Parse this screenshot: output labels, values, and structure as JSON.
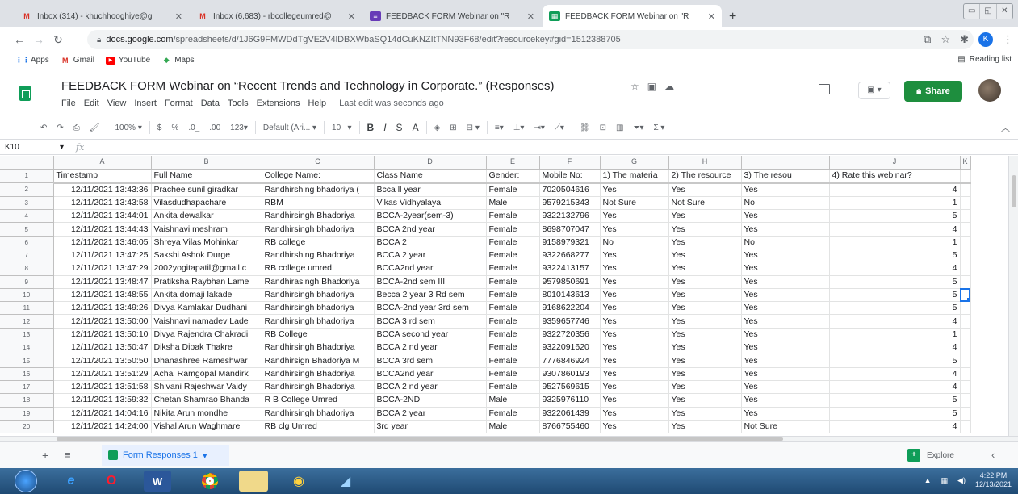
{
  "browser": {
    "tabs": [
      {
        "title": "Inbox (314) - khuchhooghiye@g",
        "favicon": "gmail-icon",
        "active": false
      },
      {
        "title": "Inbox (6,683) - rbcollegeumred@",
        "favicon": "gmail-icon",
        "active": false
      },
      {
        "title": "FEEDBACK FORM Webinar on \"R",
        "favicon": "forms-icon",
        "active": false
      },
      {
        "title": "FEEDBACK FORM Webinar on \"R",
        "favicon": "sheets-icon",
        "active": true
      }
    ],
    "url_domain": "docs.google.com",
    "url_path": "/spreadsheets/d/1J6G9FMWDdTgVE2V4lDBXWbaSQ14dCuKNZItTNN93F68/edit?resourcekey#gid=1512388705",
    "bookmarks": [
      {
        "label": "Apps",
        "icon": "apps-grid-icon"
      },
      {
        "label": "Gmail",
        "icon": "gmail-icon"
      },
      {
        "label": "YouTube",
        "icon": "youtube-icon"
      },
      {
        "label": "Maps",
        "icon": "maps-icon"
      }
    ],
    "reading_list": "Reading list",
    "profile_initial": "K"
  },
  "sheets": {
    "doc_title": "FEEDBACK FORM Webinar on “Recent Trends and Technology in Corporate.” (Responses)",
    "menu": [
      "File",
      "Edit",
      "View",
      "Insert",
      "Format",
      "Data",
      "Tools",
      "Extensions",
      "Help"
    ],
    "last_edit": "Last edit was seconds ago",
    "share_label": "Share",
    "toolbar": {
      "zoom": "100%",
      "currency": "$",
      "percent": "%",
      "dec_less": ".0_",
      "dec_more": ".00",
      "format_more": "123",
      "font": "Default (Ari...",
      "font_size": "10"
    },
    "name_box": "K10",
    "fx": "fx",
    "sheet_tab": "Form Responses 1",
    "explore_label": "Explore"
  },
  "grid": {
    "columns": [
      "A",
      "B",
      "C",
      "D",
      "E",
      "F",
      "G",
      "H",
      "I",
      "J",
      "K"
    ],
    "header": [
      "Timestamp",
      "Full Name",
      "College Name:",
      "Class Name",
      "Gender:",
      "Mobile No:",
      "1) The materia",
      "2) The resource",
      "3) The resou",
      "4) Rate this webinar?",
      ""
    ],
    "rows": [
      [
        "12/11/2021 13:43:36",
        "Prachee sunil giradkar",
        "Randhirshing bhadoriya (",
        "Bcca ll year",
        "Female",
        "7020504616",
        "Yes",
        "Yes",
        "Yes",
        "4",
        ""
      ],
      [
        "12/11/2021 13:43:58",
        "Vilasdudhapachare",
        "RBM",
        "Vikas Vidhyalaya",
        "Male",
        "9579215343",
        "Not Sure",
        "Not Sure",
        "No",
        "1",
        ""
      ],
      [
        "12/11/2021 13:44:01",
        "Ankita dewalkar",
        "Randhirsingh Bhadoriya",
        "BCCA-2year(sem-3)",
        "Female",
        "9322132796",
        "Yes",
        "Yes",
        "Yes",
        "5",
        ""
      ],
      [
        "12/11/2021 13:44:43",
        "Vaishnavi meshram",
        "Randhirsingh bhadoriya",
        "BCCA 2nd year",
        "Female",
        "8698707047",
        "Yes",
        "Yes",
        "Yes",
        "4",
        ""
      ],
      [
        "12/11/2021 13:46:05",
        "Shreya Vilas Mohinkar",
        "RB college",
        "BCCA 2",
        "Female",
        "9158979321",
        "No",
        "Yes",
        "No",
        "1",
        ""
      ],
      [
        "12/11/2021 13:47:25",
        "Sakshi Ashok Durge",
        "Randhirshing Bhadoriya",
        "BCCA 2 year",
        "Female",
        "9322668277",
        "Yes",
        "Yes",
        "Yes",
        "5",
        ""
      ],
      [
        "12/11/2021 13:47:29",
        "2002yogitapatil@gmail.c",
        "RB college umred",
        "BCCA2nd year",
        "Female",
        "9322413157",
        "Yes",
        "Yes",
        "Yes",
        "4",
        ""
      ],
      [
        "12/11/2021 13:48:47",
        "Pratiksha Raybhan Lame",
        "Randhirasingh Bhadoriya",
        "BCCA-2nd sem III",
        "Female",
        "9579850691",
        "Yes",
        "Yes",
        "Yes",
        "5",
        ""
      ],
      [
        "12/11/2021 13:48:55",
        "Ankita domaji lakade",
        "Randhirsingh bhadoriya",
        "Becca 2 year 3 Rd sem",
        "Female",
        "8010143613",
        "Yes",
        "Yes",
        "Yes",
        "5",
        ""
      ],
      [
        "12/11/2021 13:49:26",
        "Divya Kamlakar Dudhani",
        "Randhirsingh bhadoriya",
        "BCCA-2nd year 3rd sem",
        "Female",
        "9168622204",
        "Yes",
        "Yes",
        "Yes",
        "5",
        ""
      ],
      [
        "12/11/2021 13:50:00",
        "Vaishnavi namadev Lade",
        "Randhirsingh bhadoriya",
        "BCCA 3 rd sem",
        "Female",
        "9359657746",
        "Yes",
        "Yes",
        "Yes",
        "4",
        ""
      ],
      [
        "12/11/2021 13:50:10",
        "Divya Rajendra Chakradi",
        "RB College",
        "BCCA second year",
        "Female",
        "9322720356",
        "Yes",
        "Yes",
        "Yes",
        "1",
        ""
      ],
      [
        "12/11/2021 13:50:47",
        "Diksha Dipak Thakre",
        "Randhirsingh Bhadoriya",
        "BCCA 2 nd year",
        "Female",
        "9322091620",
        "Yes",
        "Yes",
        "Yes",
        "4",
        ""
      ],
      [
        "12/11/2021 13:50:50",
        "Dhanashree Rameshwar",
        "Randhirsign Bhadoriya M",
        "BCCA 3rd sem",
        "Female",
        "7776846924",
        "Yes",
        "Yes",
        "Yes",
        "5",
        ""
      ],
      [
        "12/11/2021 13:51:29",
        "Achal Ramgopal Mandirk",
        "Randhirsingh Bhadoriya",
        "BCCA2nd year",
        "Female",
        "9307860193",
        "Yes",
        "Yes",
        "Yes",
        "4",
        ""
      ],
      [
        "12/11/2021 13:51:58",
        "Shivani Rajeshwar Vaidy",
        "Randhirsingh Bhadoriya",
        "BCCA 2 nd year",
        "Female",
        "9527569615",
        "Yes",
        "Yes",
        "Yes",
        "4",
        ""
      ],
      [
        "12/11/2021 13:59:32",
        "Chetan Shamrao Bhanda",
        "R B College Umred",
        "BCCA-2ND",
        "Male",
        "9325976110",
        "Yes",
        "Yes",
        "Yes",
        "5",
        ""
      ],
      [
        "12/11/2021 14:04:16",
        "Nikita Arun mondhe",
        "Randhirsingh bhadoriya",
        "BCCA 2 year",
        "Female",
        "9322061439",
        "Yes",
        "Yes",
        "Yes",
        "5",
        ""
      ],
      [
        "12/11/2021 14:24:00",
        "Vishal Arun Waghmare",
        "RB clg Umred",
        "3rd year",
        "Male",
        "8766755460",
        "Yes",
        "Yes",
        "Not Sure",
        "4",
        ""
      ]
    ],
    "selected": {
      "row": 10,
      "col": "K"
    }
  },
  "taskbar": {
    "apps": [
      "ie-icon",
      "opera-icon",
      "word-icon",
      "chrome-icon",
      "explorer-icon",
      "media-icon",
      "paint-icon"
    ],
    "time": "4:22 PM",
    "date": "12/13/2021"
  },
  "colors": {
    "sheets_green": "#0f9d58",
    "share_green": "#1e8e3e",
    "selection_blue": "#1a73e8"
  }
}
